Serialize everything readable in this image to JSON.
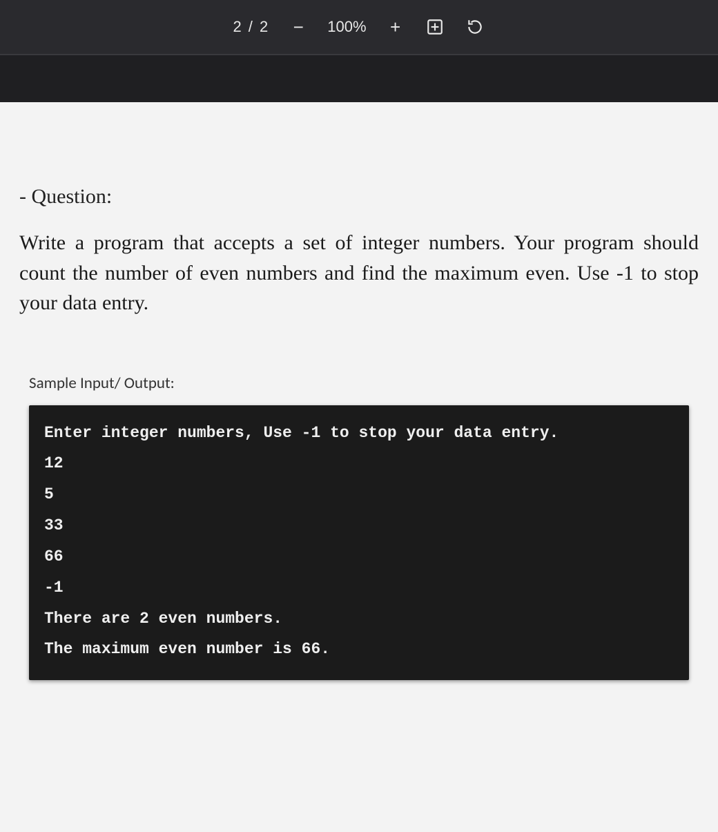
{
  "toolbar": {
    "page_indicator": "2 / 2",
    "zoom_out": "−",
    "zoom_level": "100%",
    "zoom_in": "+"
  },
  "document": {
    "question_label": "- Question:",
    "question_body": "Write a program that accepts a set of integer numbers. Your program should count the number of even numbers and find the maximum even. Use -1 to stop your data entry.",
    "sample_label": "Sample Input/ Output:",
    "console_lines": [
      "Enter integer numbers, Use -1 to stop your data entry.",
      "12",
      "5",
      "33",
      "66",
      "-1",
      "There are 2 even numbers.",
      "The maximum even number is 66."
    ]
  }
}
